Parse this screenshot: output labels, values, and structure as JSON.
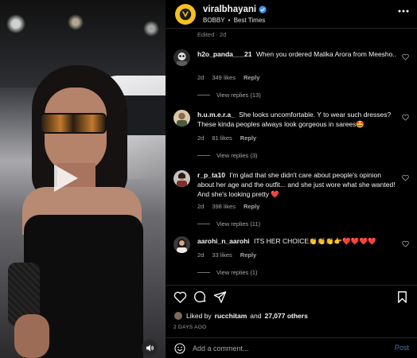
{
  "colors": {
    "background": "#000000",
    "accent_link": "#4a79a8",
    "muted_text": "#a8a8a8",
    "verified": "#3897f0",
    "brand_yellow": "#f4c21d"
  },
  "video": {
    "play_icon": "play-icon",
    "mute_icon": "speaker-icon"
  },
  "header": {
    "username": "viralbhayani",
    "song": "BOBBY",
    "separator": "•",
    "track": "Best Times",
    "more_icon": "more-options-icon"
  },
  "comments": {
    "edited": "Edited · 2d",
    "items": [
      {
        "username": "h2o_panda___21",
        "text": "When you ordered Malika Arora from Meesho..",
        "age": "2d",
        "likes": "349 likes",
        "reply": "Reply",
        "replies": "View replies (13)"
      },
      {
        "username": "h.u.m.e.r.a_",
        "text": "She looks uncomfortable. Y to wear such dresses? These kinda peoples always look gorgeous in sarees🤩",
        "age": "2d",
        "likes": "81 likes",
        "reply": "Reply",
        "replies": "View replies (3)"
      },
      {
        "username": "r_p_ta10",
        "text": "I'm glad that she didn't care about people's opinion about her age and the outfit... and she just wore what she wanted! And she's looking pretty ❤️",
        "age": "2d",
        "likes": "398 likes",
        "reply": "Reply",
        "replies": "View replies (11)"
      },
      {
        "username": "aarohi_n_aarohi",
        "text": "ITS HER CHOICE👏👏👏👉❤️❤️❤️❤️",
        "age": "2d",
        "likes": "33 likes",
        "reply": "Reply",
        "replies": "View replies (1)"
      }
    ]
  },
  "actions": {
    "liked_prefix": "Liked by",
    "liked_user": "rucchitam",
    "liked_and": "and",
    "liked_count": "27,077 others",
    "timestamp": "2 DAYS AGO"
  },
  "add_comment": {
    "placeholder": "Add a comment...",
    "post_label": "Post"
  }
}
